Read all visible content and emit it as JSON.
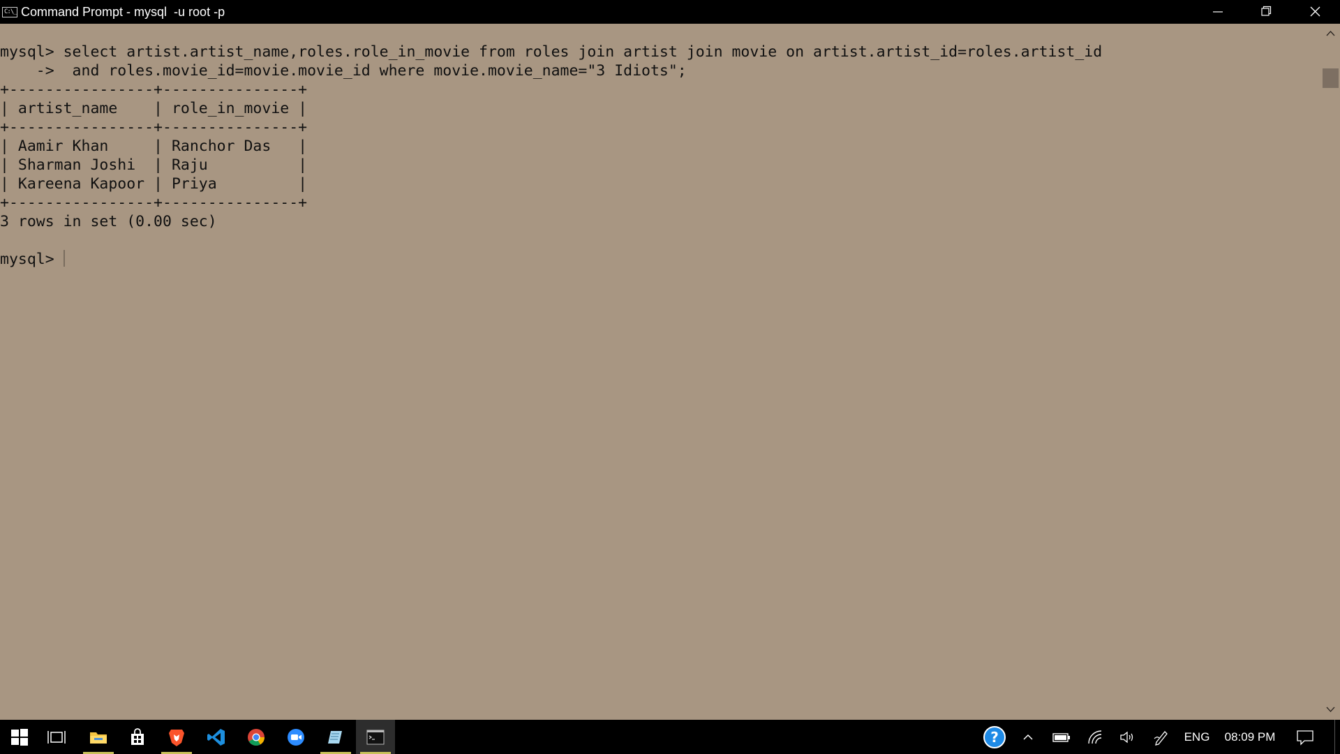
{
  "window": {
    "title": "Command Prompt - mysql  -u root -p",
    "icon_text": "C:\\_"
  },
  "console": {
    "lines": [
      "mysql> select artist.artist_name,roles.role_in_movie from roles join artist join movie on artist.artist_id=roles.artist_id",
      "    ->  and roles.movie_id=movie.movie_id where movie.movie_name=\"3 Idiots\";",
      "+----------------+---------------+",
      "| artist_name    | role_in_movie |",
      "+----------------+---------------+",
      "| Aamir Khan     | Ranchor Das   |",
      "| Sharman Joshi  | Raju          |",
      "| Kareena Kapoor | Priya         |",
      "+----------------+---------------+",
      "3 rows in set (0.00 sec)",
      "",
      "mysql> "
    ],
    "result_columns": [
      "artist_name",
      "role_in_movie"
    ],
    "result_rows": [
      [
        "Aamir Khan",
        "Ranchor Das"
      ],
      [
        "Sharman Joshi",
        "Raju"
      ],
      [
        "Kareena Kapoor",
        "Priya"
      ]
    ],
    "status": "3 rows in set (0.00 sec)",
    "prompt": "mysql> "
  },
  "taskbar": {
    "items": [
      {
        "icon": "windows-start-icon"
      },
      {
        "icon": "task-view-icon"
      },
      {
        "icon": "file-explorer-icon"
      },
      {
        "icon": "microsoft-store-icon"
      },
      {
        "icon": "brave-browser-icon"
      },
      {
        "icon": "vscode-icon"
      },
      {
        "icon": "chrome-icon"
      },
      {
        "icon": "zoom-icon"
      },
      {
        "icon": "notepad-icon"
      },
      {
        "icon": "command-prompt-icon"
      }
    ],
    "tray": {
      "language": "ENG",
      "time": "08:09 PM"
    }
  },
  "colors": {
    "console_background": "#a89682",
    "console_text": "#101010",
    "titlebar": "#000000",
    "taskbar": "#000000"
  }
}
